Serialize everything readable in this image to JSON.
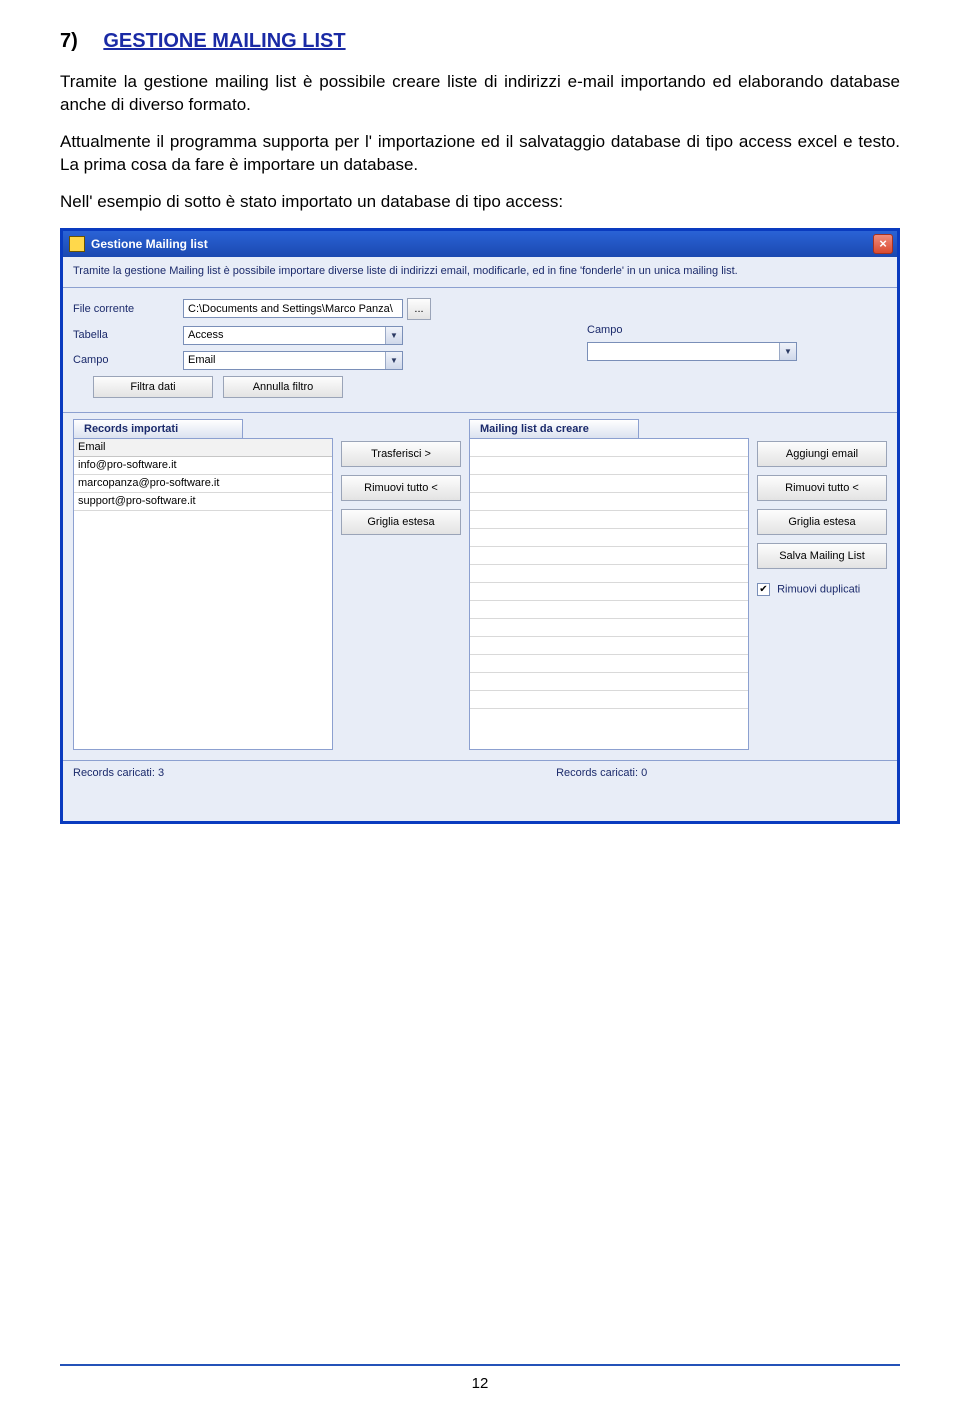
{
  "heading": {
    "num": "7)",
    "title": "GESTIONE MAILING LIST"
  },
  "para1": "Tramite la gestione mailing list è possibile creare liste di indirizzi e-mail importando ed elaborando database anche di diverso formato.",
  "para2": "Attualmente il programma supporta per l' importazione ed il salvataggio database di tipo access excel e testo. La prima cosa da fare è importare un database.",
  "para3": "Nell' esempio di sotto è stato importato un database di tipo access:",
  "win": {
    "title": "Gestione Mailing list",
    "intro": "Tramite la gestione Mailing list è possibile importare diverse liste di indirizzi email, modificarle, ed in fine 'fonderle' in un unica mailing list.",
    "labels": {
      "file": "File corrente",
      "tabella": "Tabella",
      "campo": "Campo",
      "campo2": "Campo"
    },
    "values": {
      "file": "C:\\Documents and Settings\\Marco Panza\\",
      "tabella": "Access",
      "campo": "Email",
      "campo2": ""
    },
    "buttons": {
      "browse": "...",
      "filtra": "Filtra dati",
      "annulla": "Annulla filtro",
      "trasferisci": "Trasferisci >",
      "rimuovi": "Rimuovi tutto <",
      "griglia": "Griglia estesa",
      "aggiungi": "Aggiungi email",
      "rimuovi2": "Rimuovi tutto <",
      "griglia2": "Griglia estesa",
      "salva": "Salva Mailing List"
    },
    "checkbox": "Rimuovi duplicati",
    "tabs": {
      "left": "Records importati",
      "right": "Mailing list da creare"
    },
    "gridHeader": "Email",
    "gridRows": [
      "info@pro-software.it",
      "marcopanza@pro-software.it",
      "support@pro-software.it"
    ],
    "records": {
      "left": "Records caricati: 3",
      "right": "Records caricati: 0"
    }
  },
  "pageNumber": "12"
}
